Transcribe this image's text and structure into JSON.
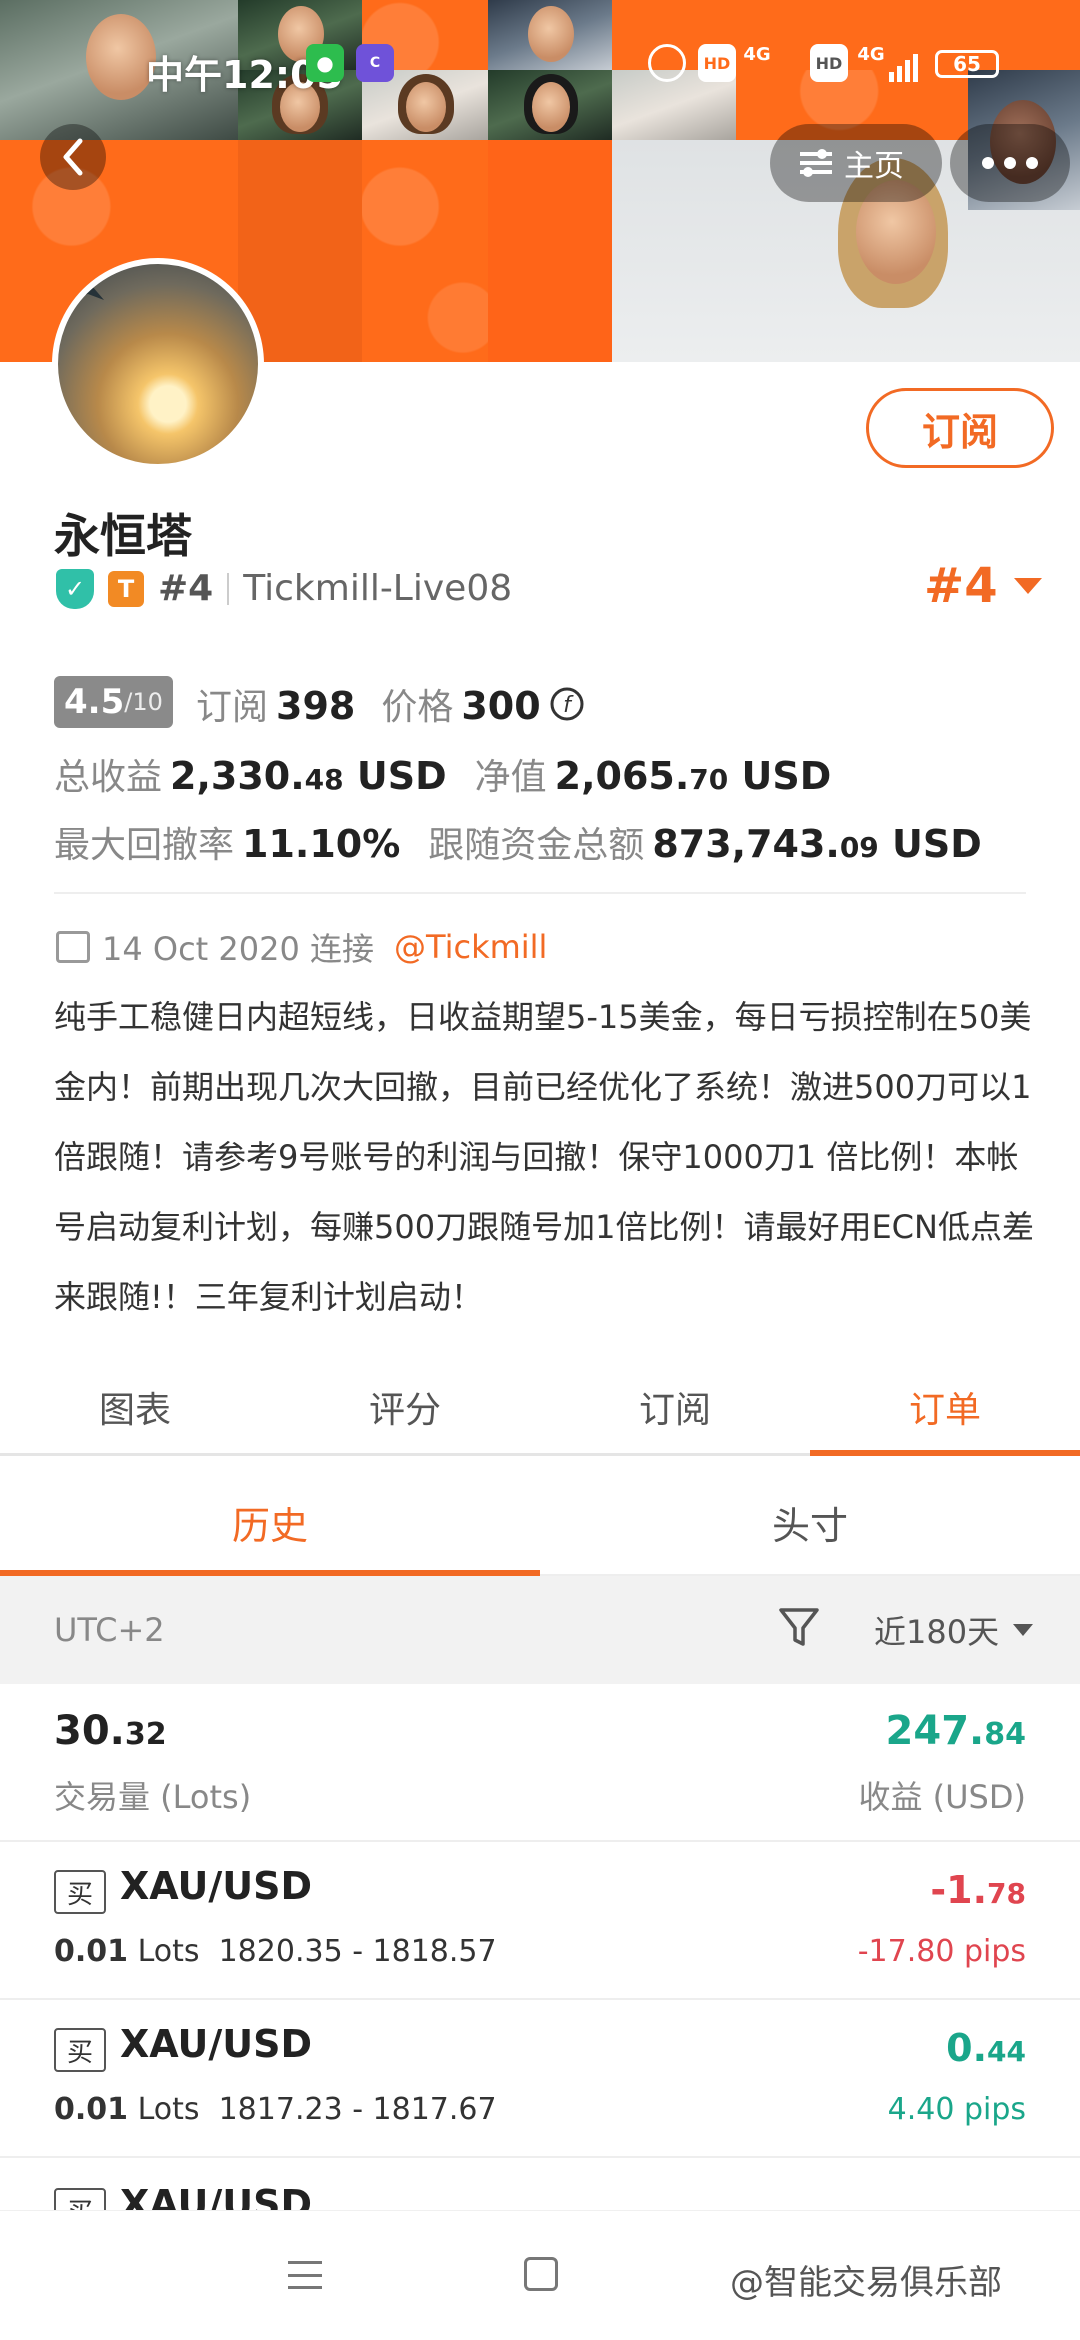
{
  "status_bar": {
    "time": "中午12:05",
    "network_1": "4G",
    "network_2": "4G",
    "hd_1": "HD",
    "hd_2": "HD",
    "battery": "65"
  },
  "header": {
    "home_label": "主页",
    "back_icon": "chevron-left-icon",
    "more_icon": "more-dots-icon"
  },
  "profile": {
    "name": "永恒塔",
    "rank_small": "#4",
    "broker_account": "Tickmill-Live08",
    "rank_large": "#4",
    "subscribe_label": "订阅",
    "tier_badge": "T",
    "rating_value": "4.5",
    "rating_max": "/10",
    "subscribers_label": "订阅",
    "subscribers_value": "398",
    "price_label": "价格",
    "price_value": "300",
    "total_profit_label": "总收益",
    "total_profit_int": "2,330.",
    "total_profit_dec": "48",
    "total_profit_unit": "USD",
    "equity_label": "净值",
    "equity_int": "2,065.",
    "equity_dec": "70",
    "equity_unit": "USD",
    "max_dd_label": "最大回撤率",
    "max_dd_value": "11.10%",
    "follow_funds_label": "跟随资金总额",
    "follow_funds_int": "873,743.",
    "follow_funds_dec": "09",
    "follow_funds_unit": "USD",
    "connect_date": "14 Oct 2020 连接",
    "broker_link": "@Tickmill",
    "description": "纯手工稳健日内超短线，日收益期望5-15美金，每日亏损控制在50美金内！前期出现几次大回撤，目前已经优化了系统！激进500刀可以1倍跟随！请参考9号账号的利润与回撤！保守1000刀1 倍比例！本帐号启动复利计划，每赚500刀跟随号加1倍比例！请最好用ECN低点差来跟随!！三年复利计划启动！"
  },
  "tabs": [
    {
      "label": "图表"
    },
    {
      "label": "评分"
    },
    {
      "label": "订阅"
    },
    {
      "label": "订单"
    }
  ],
  "subtabs": [
    {
      "label": "历史"
    },
    {
      "label": "头寸"
    }
  ],
  "filter": {
    "timezone": "UTC+2",
    "range": "近180天"
  },
  "summary": {
    "volume_int": "30.",
    "volume_dec": "32",
    "volume_label": "交易量 (Lots)",
    "profit_int": "247.",
    "profit_dec": "84",
    "profit_label": "收益 (USD)"
  },
  "orders": [
    {
      "side": "买",
      "pair": "XAU/USD",
      "lots": "0.01",
      "lots_unit": "Lots",
      "prices": "1820.35 - 1818.57",
      "profit_int": "-1.",
      "profit_dec": "78",
      "pips": "-17.80 pips"
    },
    {
      "side": "买",
      "pair": "XAU/USD",
      "lots": "0.01",
      "lots_unit": "Lots",
      "prices": "1817.23 - 1817.67",
      "profit_int": "0.",
      "profit_dec": "44",
      "pips": "4.40 pips"
    },
    {
      "side": "买",
      "pair": "XAU/USD",
      "lots": "",
      "lots_unit": "",
      "prices": "",
      "profit_int": "",
      "profit_dec": "",
      "pips": ""
    }
  ],
  "watermark": "@智能交易俱乐部"
}
